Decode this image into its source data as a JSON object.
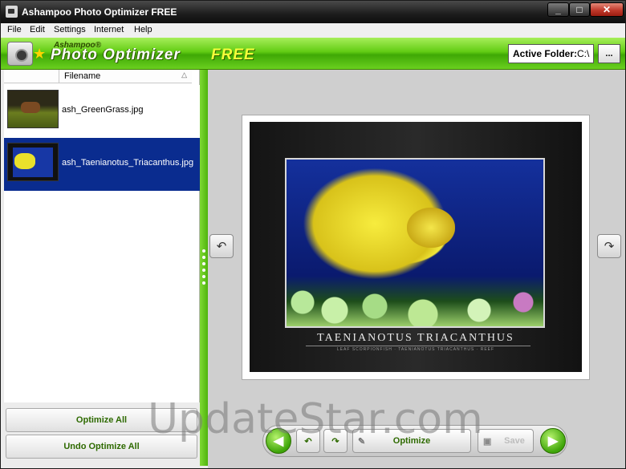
{
  "window": {
    "title": "Ashampoo Photo Optimizer FREE"
  },
  "menu": [
    "File",
    "Edit",
    "Settings",
    "Internet",
    "Help"
  ],
  "banner": {
    "brand_small": "Ashampoo®",
    "brand_main": "Photo Optimizer",
    "brand_free": "FREE",
    "active_folder_label": "Active Folder:",
    "active_folder_value": "C:\\",
    "browse_label": "..."
  },
  "file_list": {
    "column_header": "Filename",
    "sort_indicator": "△",
    "items": [
      {
        "filename": "ash_GreenGrass.jpg",
        "selected": false
      },
      {
        "filename": "ash_Taenianotus_Triacanthus.jpg",
        "selected": true
      }
    ]
  },
  "left_buttons": {
    "optimize_all": "Optimize All",
    "undo_optimize_all": "Undo Optimize All"
  },
  "preview": {
    "caption": "TAENIANOTUS TRIACANTHUS",
    "subcaption": "LEAF SCORPIONFISH · TAENIANOTUS TRIACANTHUS · REEF"
  },
  "toolbar": {
    "optimize_label": "Optimize",
    "save_label": "Save"
  },
  "watermark": "UpdateStar.com",
  "colors": {
    "accent_green": "#4fb40c",
    "selection_blue": "#0a2c8f"
  }
}
